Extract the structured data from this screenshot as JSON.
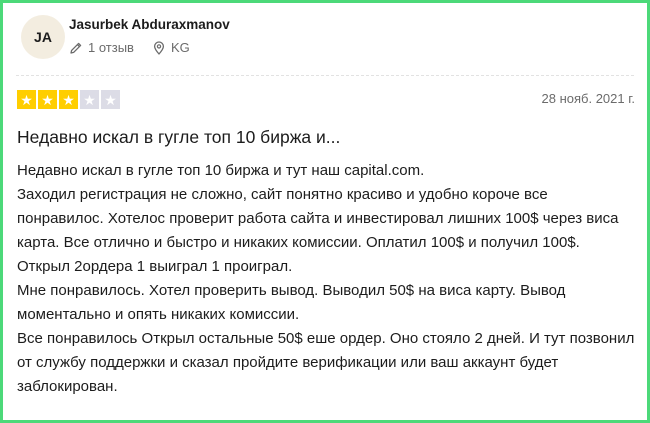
{
  "reviewer": {
    "initials": "JA",
    "name": "Jasurbek Abduraxmanov",
    "reviews_count": "1 отзыв",
    "country": "KG"
  },
  "review": {
    "rating": 3,
    "max_rating": 5,
    "date": "28 нояб. 2021 г.",
    "title": "Недавно искал в гугле топ 10 биржа и...",
    "paragraphs": [
      "Недавно искал в гугле топ 10 биржа и тут наш capital.com.",
      "Заходил регистрация не сложно, сайт понятно красиво и удобно короче все понравилос. Хотелос проверит работа сайта и инвестировал лишних 100$ через виса карта. Все отлично и быстро и никаких комиссии. Оплатил 100$ и получил 100$.",
      "Открыл 2ордера 1 выиграл 1 проиграл.",
      "Мне понравилось. Хотел проверить вывод. Выводил 50$ на виса карту. Вывод моментально и опять никаких комиссии.",
      "Все понравилось Открыл остальные 50$ еше ордер. Оно стояло 2 дней. И тут позвонил от службу поддержки и сказал пройдите верификации или ваш аккаунт будет заблокирован."
    ]
  },
  "icons": {
    "pencil": "pencil-icon",
    "location": "location-pin-icon",
    "star": "star-icon"
  },
  "colors": {
    "accent_border": "#4cd979",
    "star_filled": "#ffce00",
    "star_empty": "#dcdce6"
  }
}
